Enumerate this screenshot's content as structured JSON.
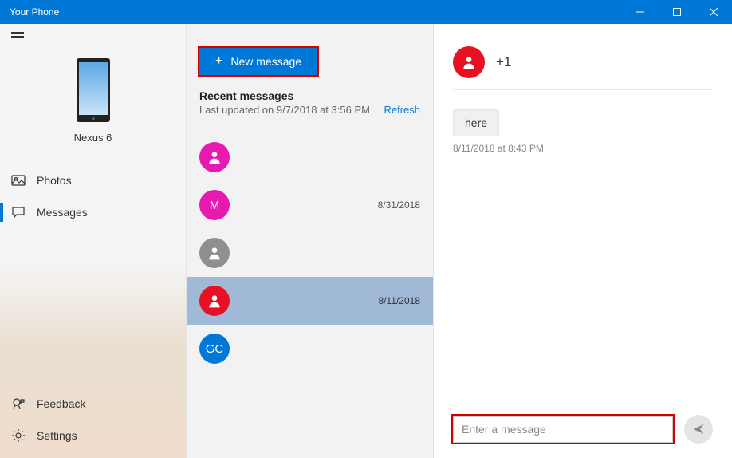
{
  "titlebar": {
    "title": "Your Phone"
  },
  "sidebar": {
    "phone_name": "Nexus 6",
    "nav": [
      {
        "label": "Photos",
        "icon": "photo-icon",
        "active": false
      },
      {
        "label": "Messages",
        "icon": "chat-icon",
        "active": true
      }
    ],
    "bottom": [
      {
        "label": "Feedback",
        "icon": "feedback-icon"
      },
      {
        "label": "Settings",
        "icon": "gear-icon"
      }
    ]
  },
  "mid": {
    "new_message": "New message",
    "recent_title": "Recent messages",
    "last_updated": "Last updated on 9/7/2018 at 3:56 PM",
    "refresh": "Refresh",
    "conversations": [
      {
        "color": "#e61ab0",
        "initials": "",
        "person_icon": true,
        "date": ""
      },
      {
        "color": "#e61ab0",
        "initials": "M",
        "person_icon": false,
        "date": "8/31/2018"
      },
      {
        "color": "#8f8f8f",
        "initials": "",
        "person_icon": true,
        "date": ""
      },
      {
        "color": "#e81123",
        "initials": "",
        "person_icon": true,
        "date": "8/11/2018",
        "selected": true
      },
      {
        "color": "#0078d7",
        "initials": "GC",
        "person_icon": false,
        "date": ""
      }
    ]
  },
  "right": {
    "contact_avatar_color": "#e81123",
    "contact_number": "+1",
    "messages": [
      {
        "text": "here",
        "time": "8/11/2018 at 8:43 PM"
      }
    ],
    "input_placeholder": "Enter a message"
  }
}
